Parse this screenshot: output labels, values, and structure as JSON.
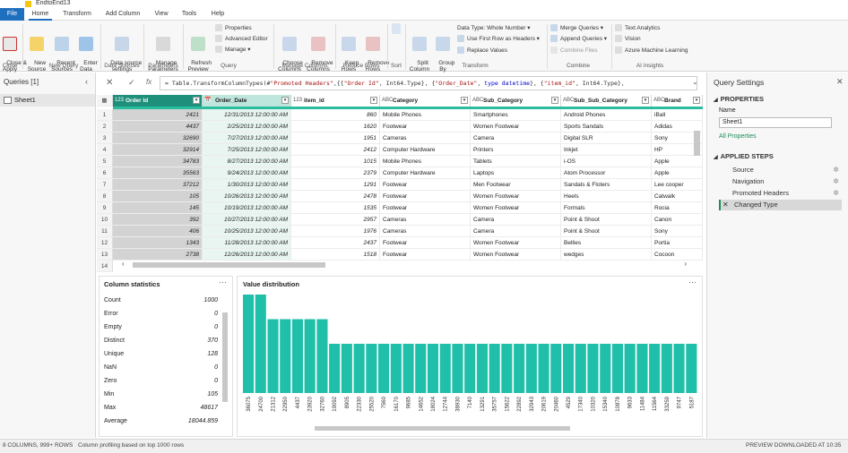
{
  "window": {
    "title": "EndtoEnd13"
  },
  "tabs": [
    "File",
    "Home",
    "Transform",
    "Add Column",
    "View",
    "Tools",
    "Help"
  ],
  "ribbon": {
    "close_apply": "Close &\nApply",
    "new_source": "New\nSource",
    "recent_sources": "Recent\nSources",
    "enter_data": "Enter\nData",
    "data_source_settings": "Data source\nsettings",
    "manage_parameters": "Manage\nParameters",
    "refresh_preview": "Refresh\nPreview",
    "properties": "Properties",
    "advanced_editor": "Advanced Editor",
    "manage": "Manage",
    "choose_columns": "Choose\nColumns",
    "remove_columns": "Remove\nColumns",
    "keep_rows": "Keep\nRows",
    "remove_rows": "Remove\nRows",
    "split_column": "Split\nColumn",
    "group_by": "Group\nBy",
    "data_type": "Data Type: Whole Number",
    "use_first_row": "Use First Row as Headers",
    "replace_values": "Replace Values",
    "merge_queries": "Merge Queries",
    "append_queries": "Append Queries",
    "combine_files": "Combine Files",
    "text_analytics": "Text Analytics",
    "vision": "Vision",
    "azure_ml": "Azure Machine Learning",
    "groups": [
      "Close",
      "New Query",
      "Data Sources",
      "Parameters",
      "Query",
      "Manage Columns",
      "Reduce Rows",
      "Sort",
      "Transform",
      "Combine",
      "AI Insights"
    ]
  },
  "queries": {
    "header": "Queries [1]",
    "items": [
      "Sheet1"
    ]
  },
  "formula": {
    "text_parts": [
      {
        "t": "= Table.TransformColumnTypes(#",
        "c": ""
      },
      {
        "t": "\"Promoted Headers\"",
        "c": "str"
      },
      {
        "t": ",{{",
        "c": ""
      },
      {
        "t": "\"Order Id\"",
        "c": "str"
      },
      {
        "t": ", Int64.Type}, {",
        "c": ""
      },
      {
        "t": "\"Order_Date\"",
        "c": "str"
      },
      {
        "t": ", ",
        "c": ""
      },
      {
        "t": "type datetime",
        "c": "kw"
      },
      {
        "t": "}, {",
        "c": ""
      },
      {
        "t": "\"item_id\"",
        "c": "str"
      },
      {
        "t": ", Int64.Type},",
        "c": ""
      }
    ]
  },
  "table": {
    "columns": [
      {
        "name": "Order Id",
        "type": "123"
      },
      {
        "name": "Order_Date",
        "type": "📅"
      },
      {
        "name": "item_id",
        "type": "123"
      },
      {
        "name": "Category",
        "type": "ABC"
      },
      {
        "name": "Sub_Category",
        "type": "ABC"
      },
      {
        "name": "Sub_Sub_Category",
        "type": "ABC"
      },
      {
        "name": "Brand",
        "type": "ABC"
      }
    ],
    "rows": [
      [
        "2421",
        "12/31/2013 12:00:00 AM",
        "860",
        "Mobile Phones",
        "Smartphones",
        "Android Phones",
        "iBall"
      ],
      [
        "4437",
        "2/25/2013 12:00:00 AM",
        "1620",
        "Footwear",
        "Women Footwear",
        "Sports Sandals",
        "Adidas"
      ],
      [
        "32690",
        "7/27/2013 12:00:00 AM",
        "1951",
        "Cameras",
        "Camera",
        "Digital SLR",
        "Sony"
      ],
      [
        "32914",
        "7/25/2013 12:00:00 AM",
        "2412",
        "Computer Hardware",
        "Printers",
        "Inkjet",
        "HP"
      ],
      [
        "34783",
        "8/27/2013 12:00:00 AM",
        "1015",
        "Mobile Phones",
        "Tablets",
        "i-OS",
        "Apple"
      ],
      [
        "35563",
        "9/24/2013 12:00:00 AM",
        "2379",
        "Computer Hardware",
        "Laptops",
        "Atom Processor",
        "Apple"
      ],
      [
        "37212",
        "1/30/2013 12:00:00 AM",
        "1291",
        "Footwear",
        "Men Footwear",
        "Sandals & Floters",
        "Lee cooper"
      ],
      [
        "105",
        "10/26/2013 12:00:00 AM",
        "2478",
        "Footwear",
        "Women Footwear",
        "Heels",
        "Catwalk"
      ],
      [
        "145",
        "10/19/2013 12:00:00 AM",
        "1535",
        "Footwear",
        "Women Footwear",
        "Formals",
        "Rocia"
      ],
      [
        "392",
        "10/27/2013 12:00:00 AM",
        "2957",
        "Cameras",
        "Camera",
        "Point & Shoot",
        "Canon"
      ],
      [
        "406",
        "10/25/2013 12:00:00 AM",
        "1976",
        "Cameras",
        "Camera",
        "Point & Shoot",
        "Sony"
      ],
      [
        "1343",
        "11/28/2013 12:00:00 AM",
        "2437",
        "Footwear",
        "Women Footwear",
        "Bellies",
        "Portia"
      ],
      [
        "2738",
        "12/26/2013 12:00:00 AM",
        "1518",
        "Footwear",
        "Women Footwear",
        "wedges",
        "Cocoon"
      ]
    ],
    "row_numbers": [
      "1",
      "2",
      "3",
      "4",
      "5",
      "6",
      "7",
      "8",
      "9",
      "10",
      "11",
      "12",
      "13",
      "14"
    ]
  },
  "column_statistics": {
    "title": "Column statistics",
    "items": [
      {
        "label": "Count",
        "value": "1000"
      },
      {
        "label": "Error",
        "value": "0"
      },
      {
        "label": "Empty",
        "value": "0"
      },
      {
        "label": "Distinct",
        "value": "370"
      },
      {
        "label": "Unique",
        "value": "128"
      },
      {
        "label": "NaN",
        "value": "0"
      },
      {
        "label": "Zero",
        "value": "0"
      },
      {
        "label": "Min",
        "value": "105"
      },
      {
        "label": "Max",
        "value": "48617"
      },
      {
        "label": "Average",
        "value": "18044.859"
      }
    ]
  },
  "value_distribution": {
    "title": "Value distribution"
  },
  "chart_data": {
    "type": "bar",
    "title": "Value distribution",
    "categories": [
      "36075",
      "24700",
      "21312",
      "22950",
      "4437",
      "23920",
      "32760",
      "19092",
      "8905",
      "22330",
      "25520",
      "7560",
      "16170",
      "9685",
      "14652",
      "18024",
      "12744",
      "38930",
      "7140",
      "13291",
      "35757",
      "15622",
      "22892",
      "32943",
      "20619",
      "20460",
      "4529",
      "17340",
      "10320",
      "15340",
      "10878",
      "9633",
      "11484",
      "11564",
      "33259",
      "9747",
      "5187"
    ],
    "values": [
      4,
      4,
      3,
      3,
      3,
      3,
      3,
      2,
      2,
      2,
      2,
      2,
      2,
      2,
      2,
      2,
      2,
      2,
      2,
      2,
      2,
      2,
      2,
      2,
      2,
      2,
      2,
      2,
      2,
      2,
      2,
      2,
      2,
      2,
      2,
      2,
      2
    ],
    "colors": {
      "bar": "#20bfa9"
    }
  },
  "query_settings": {
    "title": "Query Settings",
    "properties_header": "PROPERTIES",
    "name_label": "Name",
    "name_value": "Sheet1",
    "all_properties": "All Properties",
    "steps_header": "APPLIED STEPS",
    "steps": [
      "Source",
      "Navigation",
      "Promoted Headers",
      "Changed Type"
    ]
  },
  "status": {
    "columns_rows": "8 COLUMNS, 999+ ROWS",
    "profiling": "Column profiling based on top 1000 rows",
    "preview": "PREVIEW DOWNLOADED AT 10:35 PM"
  },
  "colors": {
    "accent": "#1f6fbf",
    "teal": "#20bfa9",
    "selected_header": "#1e8f7a"
  }
}
